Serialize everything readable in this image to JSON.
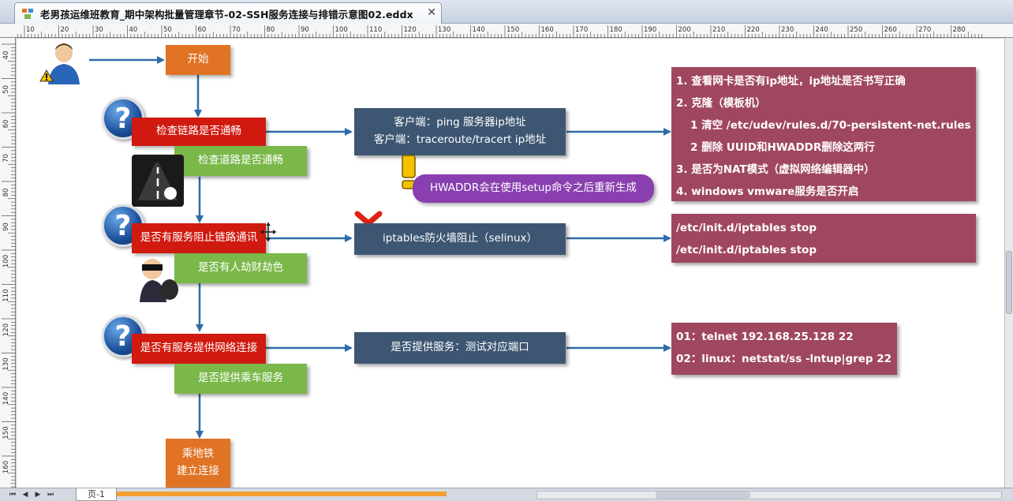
{
  "window": {
    "title": "老男孩运维班教育_期中架构批量管理章节-02-SSH服务连接与排错示意图02.eddx",
    "close": "✕"
  },
  "ruler": {
    "top_labels": [
      "10",
      "20",
      "30",
      "40",
      "50",
      "60",
      "70",
      "80",
      "90",
      "100",
      "110",
      "120",
      "130",
      "140",
      "150",
      "160",
      "170",
      "180",
      "190",
      "200",
      "210",
      "220",
      "230",
      "240",
      "250",
      "260",
      "270",
      "280"
    ],
    "left_labels": [
      "40",
      "50",
      "60",
      "70",
      "80",
      "90",
      "100",
      "110",
      "120",
      "130",
      "140",
      "150",
      "160"
    ]
  },
  "diagram": {
    "start": "开始",
    "step1": {
      "check": "检查链路是否通畅",
      "sub": "检查道路是否通畅"
    },
    "step2": {
      "check": "是否有服务阻止链路通讯",
      "sub": "是否有人劫财劫色"
    },
    "step3": {
      "check": "是否有服务提供网络连接",
      "sub": "是否提供乘车服务"
    },
    "end": {
      "line1": "乘地铁",
      "line2": "建立连接"
    },
    "client_box": {
      "line1": "客户端：ping 服务器ip地址",
      "line2": "客户端：traceroute/tracert ip地址"
    },
    "firewall_box": "iptables防火墙阻止（selinux）",
    "service_box": "是否提供服务：测试对应端口",
    "hwaddr_note": "HWADDR会在使用setup命令之后重新生成",
    "network_notes": [
      "1. 查看网卡是否有ip地址，ip地址是否书写正确",
      "2. 克隆（模板机）",
      "1 清空 /etc/udev/rules.d/70-persistent-net.rules",
      "2 删除 UUID和HWADDR删除这两行",
      "3. 是否为NAT模式（虚拟网络编辑器中）",
      "4. windows vmware服务是否开启"
    ],
    "iptables_notes": [
      "/etc/init.d/iptables stop",
      "/etc/init.d/iptables stop"
    ],
    "port_notes": [
      "01：telnet 192.168.25.128 22",
      "02：linux：netstat/ss -lntup|grep 22"
    ]
  },
  "status": {
    "page_tab": "页-1"
  },
  "colors": {
    "orange": "#e07324",
    "red": "#d01a10",
    "green": "#7ab84a",
    "navy": "#3d5672",
    "maroon": "#a04760",
    "purple": "#8a3fb0",
    "arrow": "#2e6ca8"
  }
}
